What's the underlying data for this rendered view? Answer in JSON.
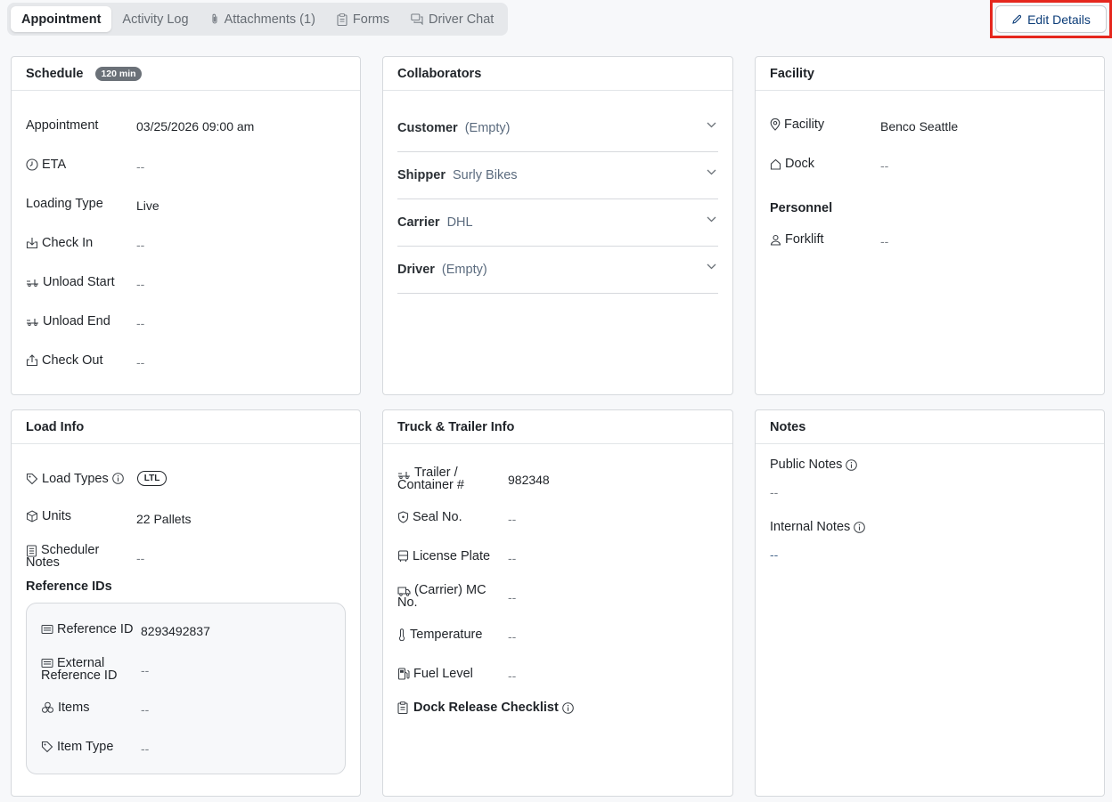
{
  "tabs": [
    {
      "label": "Appointment",
      "active": true,
      "icon": ""
    },
    {
      "label": "Activity Log",
      "active": false,
      "icon": ""
    },
    {
      "label": "Attachments (1)",
      "active": false,
      "icon": "paperclip-icon"
    },
    {
      "label": "Forms",
      "active": false,
      "icon": "clipboard-icon"
    },
    {
      "label": "Driver Chat",
      "active": false,
      "icon": "chat-icon"
    }
  ],
  "edit_button": {
    "label": "Edit Details",
    "icon": "pencil-icon"
  },
  "schedule": {
    "title": "Schedule",
    "badge": "120 min",
    "rows": [
      {
        "label": "Appointment",
        "value": "03/25/2026 09:00 am",
        "icon": ""
      },
      {
        "label": "ETA",
        "value": "--",
        "icon": "clock-icon"
      },
      {
        "label": "Loading Type",
        "value": "Live",
        "icon": ""
      },
      {
        "label": "Check In",
        "value": "--",
        "icon": "check-in-icon"
      },
      {
        "label": "Unload Start",
        "value": "--",
        "icon": "forklift-icon"
      },
      {
        "label": "Unload End",
        "value": "--",
        "icon": "forklift-icon"
      },
      {
        "label": "Check Out",
        "value": "--",
        "icon": "check-out-icon"
      }
    ]
  },
  "collaborators": {
    "title": "Collaborators",
    "items": [
      {
        "label": "Customer",
        "value": "(Empty)"
      },
      {
        "label": "Shipper",
        "value": "Surly Bikes"
      },
      {
        "label": "Carrier",
        "value": "DHL"
      },
      {
        "label": "Driver",
        "value": "(Empty)"
      }
    ]
  },
  "facility": {
    "title": "Facility",
    "facility_label": "Facility",
    "facility_value": "Benco Seattle",
    "dock_label": "Dock",
    "dock_value": "--",
    "personnel_title": "Personnel",
    "forklift_label": "Forklift",
    "forklift_value": "--"
  },
  "load_info": {
    "title": "Load Info",
    "load_types_label": "Load Types",
    "load_types_value": "LTL",
    "units_label": "Units",
    "units_value": "22 Pallets",
    "scheduler_notes_label_1": "Scheduler",
    "scheduler_notes_label_2": "Notes",
    "scheduler_notes_value": "--",
    "reference_ids_title": "Reference IDs",
    "reference_id_label": "Reference ID",
    "reference_id_value": "8293492837",
    "external_ref_label_1": "External",
    "external_ref_label_2": "Reference ID",
    "external_ref_value": "--",
    "items_label": "Items",
    "items_value": "--",
    "item_type_label": "Item Type",
    "item_type_value": "--"
  },
  "truck_trailer": {
    "title": "Truck & Trailer Info",
    "trailer_label_1": "Trailer /",
    "trailer_label_2": "Container #",
    "trailer_value": "982348",
    "seal_label": "Seal No.",
    "seal_value": "--",
    "plate_label": "License Plate",
    "plate_value": "--",
    "mc_label_1": "(Carrier) MC",
    "mc_label_2": "No.",
    "mc_value": "--",
    "temp_label": "Temperature",
    "temp_value": "--",
    "fuel_label": "Fuel Level",
    "fuel_value": "--",
    "checklist_label": "Dock Release Checklist"
  },
  "notes": {
    "title": "Notes",
    "public_label": "Public Notes",
    "public_value": "--",
    "internal_label": "Internal Notes",
    "internal_value": "--"
  }
}
